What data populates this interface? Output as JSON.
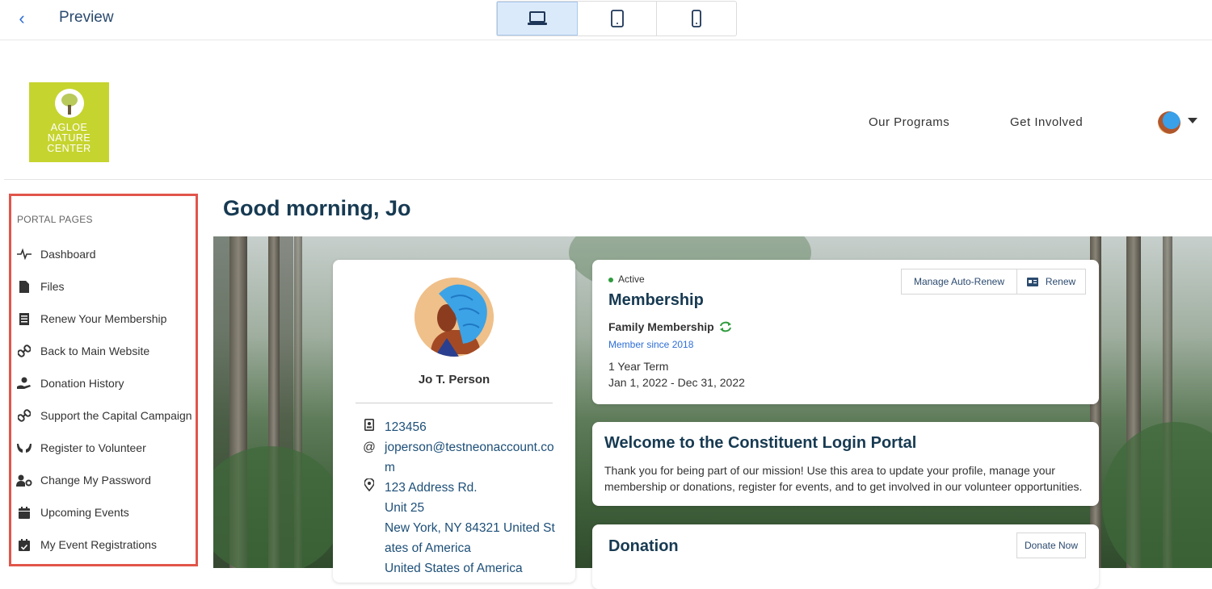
{
  "topbar": {
    "back_icon": "chevron-left-icon",
    "title": "Preview",
    "devices": [
      {
        "name": "laptop",
        "icon": "laptop-icon",
        "active": true
      },
      {
        "name": "tablet",
        "icon": "tablet-icon",
        "active": false
      },
      {
        "name": "mobile",
        "icon": "mobile-icon",
        "active": false
      }
    ]
  },
  "site": {
    "logo_lines": [
      "AGLOE",
      "NATURE",
      "CENTER"
    ],
    "logo_color": "#c6d42f",
    "nav": [
      "Our Programs",
      "Get Involved"
    ]
  },
  "sidebar": {
    "heading": "PORTAL PAGES",
    "items": [
      {
        "label": "Dashboard",
        "icon": "pulse-icon"
      },
      {
        "label": "Files",
        "icon": "file-icon"
      },
      {
        "label": "Renew Your Membership",
        "icon": "list-doc-icon"
      },
      {
        "label": "Back to Main Website",
        "icon": "link-icon"
      },
      {
        "label": "Donation History",
        "icon": "hand-heart-icon"
      },
      {
        "label": "Support the Capital Campaign",
        "icon": "link-icon"
      },
      {
        "label": "Register to Volunteer",
        "icon": "hands-icon"
      },
      {
        "label": "Change My Password",
        "icon": "user-gear-icon"
      },
      {
        "label": "Upcoming Events",
        "icon": "calendar-icon"
      },
      {
        "label": "My Event Registrations",
        "icon": "calendar-check-icon"
      }
    ],
    "highlight_color": "#e1554a"
  },
  "main": {
    "greeting": "Good morning, Jo",
    "profile": {
      "name": "Jo T. Person",
      "id": "123456",
      "email": "joperson@testneonaccount.com",
      "address_lines": [
        "123 Address Rd.",
        "Unit 25",
        "New York, NY 84321 United States of America",
        "United States of America"
      ]
    },
    "membership": {
      "status": "Active",
      "title": "Membership",
      "manage_label": "Manage Auto-Renew",
      "renew_label": "Renew",
      "type": "Family Membership",
      "since": "Member since 2018",
      "term": "1 Year Term",
      "dates": "Jan 1, 2022 - Dec 31, 2022"
    },
    "welcome": {
      "title": "Welcome to the Constituent Login Portal",
      "body": "Thank you for being part of our mission! Use this area to update your profile, manage your membership or donations, register for events, and to get involved in our volunteer opportunities."
    },
    "donation": {
      "title": "Donation",
      "button": "Donate Now"
    }
  }
}
